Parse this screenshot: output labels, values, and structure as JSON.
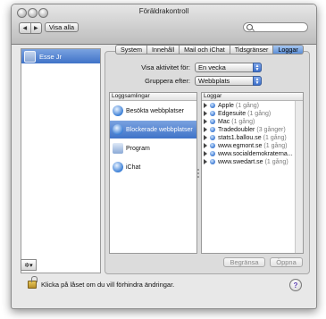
{
  "window": {
    "title": "Föräldrakontroll"
  },
  "toolbar": {
    "back_glyph": "◀",
    "forward_glyph": "▶",
    "show_all_label": "Visa alla",
    "search_placeholder": ""
  },
  "sidebar": {
    "users": [
      {
        "name": "Esse Jr"
      }
    ],
    "gear_glyph": "✲▾"
  },
  "tabs": [
    {
      "label": "System",
      "active": false
    },
    {
      "label": "Innehåll",
      "active": false
    },
    {
      "label": "Mail och iChat",
      "active": false
    },
    {
      "label": "Tidsgränser",
      "active": false
    },
    {
      "label": "Loggar",
      "active": true
    }
  ],
  "filters": {
    "activity_label": "Visa aktivitet för:",
    "activity_value": "En vecka",
    "group_label": "Gruppera efter:",
    "group_value": "Webbplats"
  },
  "collections": {
    "header": "Loggsamlingar",
    "items": [
      {
        "label": "Besökta webbplatser",
        "icon": "globe-icon",
        "selected": false
      },
      {
        "label": "Blockerade webbplatser",
        "icon": "globe-icon",
        "selected": true
      },
      {
        "label": "Program",
        "icon": "folder-icon",
        "selected": false
      },
      {
        "label": "iChat",
        "icon": "chat-icon",
        "selected": false
      }
    ]
  },
  "logs": {
    "header": "Loggar",
    "rows": [
      {
        "site": "Apple",
        "count": "(1 gång)"
      },
      {
        "site": "Edgesuite",
        "count": "(1 gång)"
      },
      {
        "site": "Mac",
        "count": "(1 gång)"
      },
      {
        "site": "Tradedoubler",
        "count": "(3 gånger)"
      },
      {
        "site": "stats1.ballou.se",
        "count": "(1 gång)"
      },
      {
        "site": "www.egmont.se",
        "count": "(1 gång)"
      },
      {
        "site": "www.socialdemokraterna...",
        "count": ""
      },
      {
        "site": "www.swedart.se",
        "count": "(1 gång)"
      }
    ]
  },
  "actions": {
    "restrict_label": "Begränsa",
    "open_label": "Öppna"
  },
  "footer": {
    "lock_text": "Klicka på låset om du vill förhindra ändringar.",
    "help_glyph": "?"
  },
  "colors": {
    "selection": "#3f73c8",
    "tab_active": "#5b8fd8"
  }
}
